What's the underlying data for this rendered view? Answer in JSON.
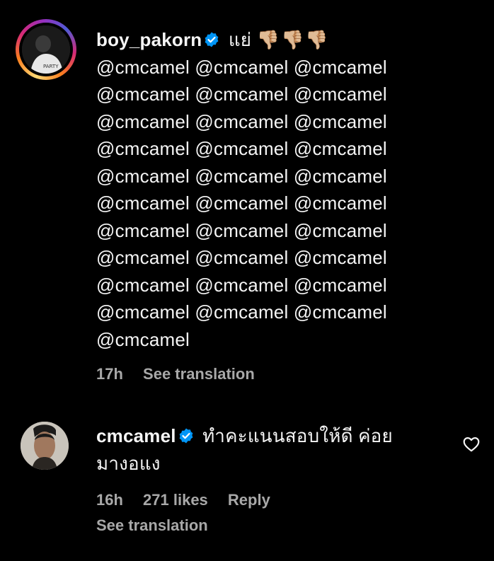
{
  "comments": [
    {
      "username": "boy_pakorn",
      "text_prefix": "แย่",
      "emoji": "👎🏼👎🏼👎🏼",
      "mention_lines": [
        "@cmcamel @cmcamel @cmcamel",
        "@cmcamel @cmcamel @cmcamel",
        "@cmcamel @cmcamel @cmcamel",
        "@cmcamel @cmcamel @cmcamel",
        "@cmcamel @cmcamel @cmcamel",
        "@cmcamel @cmcamel @cmcamel",
        "@cmcamel @cmcamel @cmcamel",
        "@cmcamel @cmcamel @cmcamel",
        "@cmcamel @cmcamel @cmcamel",
        "@cmcamel @cmcamel @cmcamel",
        "@cmcamel"
      ],
      "time": "17h",
      "see_translation": "See translation"
    },
    {
      "username": "cmcamel",
      "text_line1": "ทำคะแนนสอบให้ดี ค่อย",
      "text_line2": "มางอแง",
      "time": "16h",
      "likes": "271 likes",
      "reply": "Reply",
      "see_translation": "See translation"
    }
  ],
  "colors": {
    "background": "#000000",
    "text": "#f5f5f5",
    "meta": "#a8a8a8",
    "verified": "#0095f6"
  },
  "icons": {
    "verified": "verified-badge-icon",
    "like": "heart-outline-icon"
  }
}
